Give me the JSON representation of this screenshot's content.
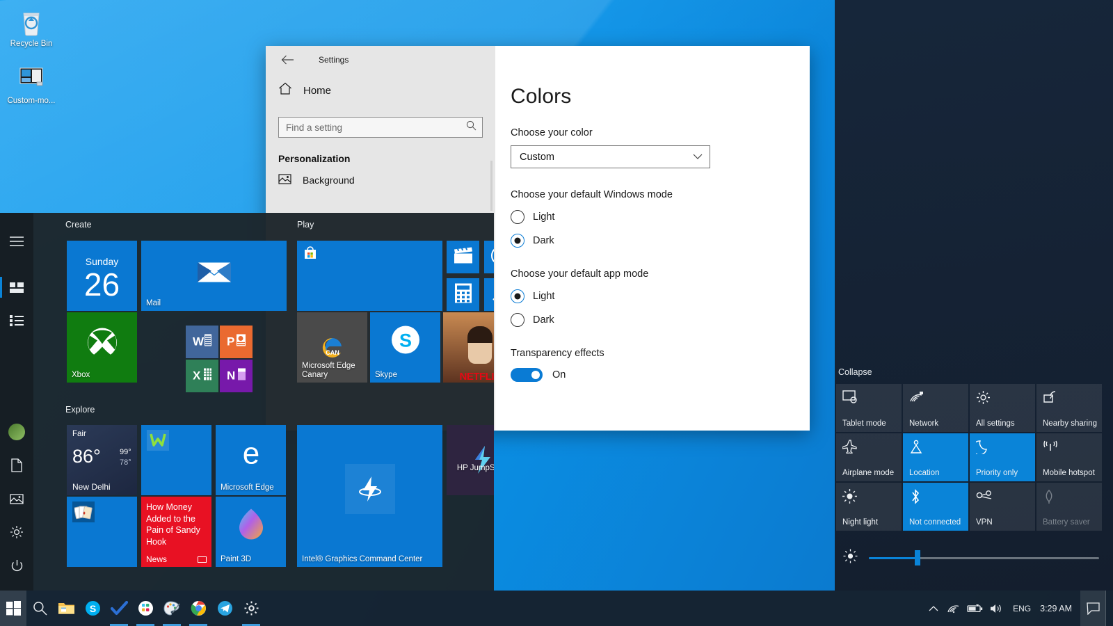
{
  "desktop": {
    "icons": [
      {
        "label": "Recycle Bin",
        "icon": "recycle-bin-icon"
      },
      {
        "label": "Custom-mo...",
        "icon": "image-file-icon"
      }
    ]
  },
  "settings": {
    "title": "Settings",
    "back_icon": "back-arrow-icon",
    "home_label": "Home",
    "home_icon": "home-icon",
    "search_placeholder": "Find a setting",
    "search_value": "",
    "search_icon": "search-icon",
    "category": "Personalization",
    "nav_items": [
      {
        "label": "Background",
        "icon": "picture-icon"
      }
    ],
    "page_title": "Colors",
    "choose_color_label": "Choose your color",
    "color_value": "Custom",
    "windows_mode_label": "Choose your default Windows mode",
    "windows_mode_options": [
      {
        "label": "Light",
        "selected": false
      },
      {
        "label": "Dark",
        "selected": true
      }
    ],
    "app_mode_label": "Choose your default app mode",
    "app_mode_options": [
      {
        "label": "Light",
        "selected": true
      },
      {
        "label": "Dark",
        "selected": false
      }
    ],
    "transparency_label": "Transparency effects",
    "transparency_state": "On"
  },
  "start": {
    "rail": [
      {
        "name": "hamburger-icon",
        "label": ""
      },
      {
        "name": "pinned-tiles-icon",
        "label": ""
      },
      {
        "name": "all-apps-icon",
        "label": ""
      },
      {
        "name": "user-avatar",
        "label": ""
      },
      {
        "name": "documents-icon",
        "label": ""
      },
      {
        "name": "pictures-icon",
        "label": ""
      },
      {
        "name": "settings-gear-icon",
        "label": ""
      },
      {
        "name": "power-icon",
        "label": ""
      }
    ],
    "groups": [
      {
        "title": "Create"
      },
      {
        "title": "Play"
      },
      {
        "title": "Explore"
      }
    ],
    "tiles": {
      "calendar": {
        "dow": "Sunday",
        "day": "26"
      },
      "mail": {
        "label": "Mail"
      },
      "xbox": {
        "label": "Xbox"
      },
      "word": {
        "label": "W"
      },
      "powerpoint": {
        "label": "P"
      },
      "excel": {
        "label": "X"
      },
      "onenote": {
        "label": "N"
      },
      "store": {
        "label": ""
      },
      "movies": {
        "label": ""
      },
      "groove": {
        "label": ""
      },
      "calculator": {
        "label": ""
      },
      "camera": {
        "label": ""
      },
      "edge_canary": {
        "label": "Microsoft Edge Canary"
      },
      "skype": {
        "label": "Skype"
      },
      "netflix": {
        "label": "NETFLIX"
      },
      "weather": {
        "cond": "Fair",
        "temp": "86°",
        "high": "99°",
        "low": "78°",
        "city": "New Delhi"
      },
      "whatsapp": {
        "label": ""
      },
      "edge": {
        "label": "Microsoft Edge"
      },
      "solitaire": {
        "label": ""
      },
      "news": {
        "headline": "How Money Added to the Pain of Sandy Hook",
        "source": "News"
      },
      "paint3d": {
        "label": "Paint 3D"
      },
      "intel": {
        "label": "Intel® Graphics Command Center"
      },
      "hp": {
        "label": "HP JumpStart"
      }
    }
  },
  "action_center": {
    "collapse_label": "Collapse",
    "quick_actions": [
      {
        "label": "Tablet mode",
        "icon": "tablet-mode-icon",
        "state": "off"
      },
      {
        "label": "Network",
        "icon": "network-icon",
        "state": "off"
      },
      {
        "label": "All settings",
        "icon": "gear-icon",
        "state": "off"
      },
      {
        "label": "Nearby sharing",
        "icon": "nearby-sharing-icon",
        "state": "off"
      },
      {
        "label": "Airplane mode",
        "icon": "airplane-icon",
        "state": "off"
      },
      {
        "label": "Location",
        "icon": "location-icon",
        "state": "on"
      },
      {
        "label": "Priority only",
        "icon": "moon-icon",
        "state": "on"
      },
      {
        "label": "Mobile hotspot",
        "icon": "hotspot-icon",
        "state": "off"
      },
      {
        "label": "Night light",
        "icon": "sun-icon",
        "state": "off"
      },
      {
        "label": "Not connected",
        "icon": "bluetooth-icon",
        "state": "on"
      },
      {
        "label": "VPN",
        "icon": "vpn-icon",
        "state": "off"
      },
      {
        "label": "Battery saver",
        "icon": "battery-leaf-icon",
        "state": "disabled"
      }
    ],
    "brightness": {
      "icon": "brightness-icon",
      "value": 21
    }
  },
  "taskbar": {
    "start_button": "windows-start-icon",
    "items": [
      {
        "name": "search-icon",
        "active": false
      },
      {
        "name": "file-explorer-icon",
        "active": false
      },
      {
        "name": "skype-icon",
        "active": false
      },
      {
        "name": "todo-icon",
        "active": true
      },
      {
        "name": "slack-icon",
        "active": true
      },
      {
        "name": "paint-icon",
        "active": true
      },
      {
        "name": "chrome-icon",
        "active": true
      },
      {
        "name": "telegram-icon",
        "active": false
      },
      {
        "name": "settings-icon",
        "active": true
      }
    ],
    "tray": {
      "chevron_icon": "show-hidden-icons-chevron",
      "wifi_icon": "wifi-icon",
      "battery_icon": "battery-icon",
      "volume_icon": "volume-icon",
      "language": "ENG",
      "clock": "3:29 AM",
      "action_center_icon": "action-center-icon"
    }
  }
}
